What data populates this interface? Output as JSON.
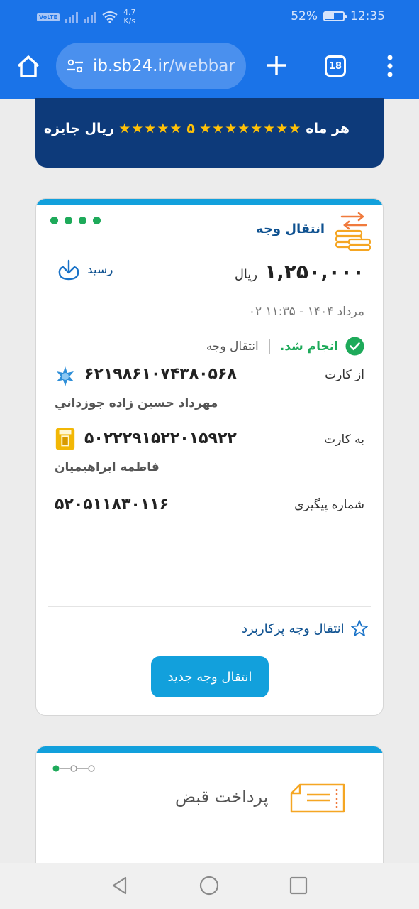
{
  "status_bar": {
    "volte": "VoLTE",
    "speed": "4.7",
    "speed_unit": "K/s",
    "battery": "52%",
    "time": "12:35",
    "battery_level": 0.52
  },
  "browser": {
    "url_host": "ib.sb24.ir",
    "url_path": "/webbar",
    "tab_count": "18"
  },
  "banner": {
    "text_start": "هر ماه",
    "stars": "★★★★★★★★",
    "five": "۵",
    "stars2": "★★★★★",
    "text_end": "ریال جایزه"
  },
  "receipt_card": {
    "title": "انتقال وجه",
    "receipt_label": "رسید",
    "amount": "۱,۲۵۰,۰۰۰",
    "currency": "ریال",
    "datetime": "۰۲ مرداد ۱۴۰۴ - ۱۱:۳۵",
    "status": "انجام شد.",
    "transaction_type": "انتقال وجه",
    "from_label": "از کارت",
    "from_card": "۶۲۱۹۸۶۱۰۷۴۳۸۰۵۶۸",
    "from_name": "مهرداد حسين زاده جوزداني",
    "to_label": "به کارت",
    "to_card": "۵۰۲۲۲۹۱۵۲۲۰۱۵۹۲۲",
    "to_name": "فاطمه ابراهیمیان",
    "tracking_label": "شماره پیگیری",
    "tracking_number": "۵۲۰۵۱۱۸۳۰۱۱۶",
    "favorite_label": "انتقال وجه پرکاربرد",
    "new_transfer_button": "انتقال وجه جدید",
    "page_dots": 4
  },
  "bill_card": {
    "title": "پرداخت قبض"
  },
  "colors": {
    "browser_blue": "#1a73e8",
    "accent": "#12a0dc",
    "success": "#1eaa5a",
    "title_blue": "#0e5190"
  }
}
